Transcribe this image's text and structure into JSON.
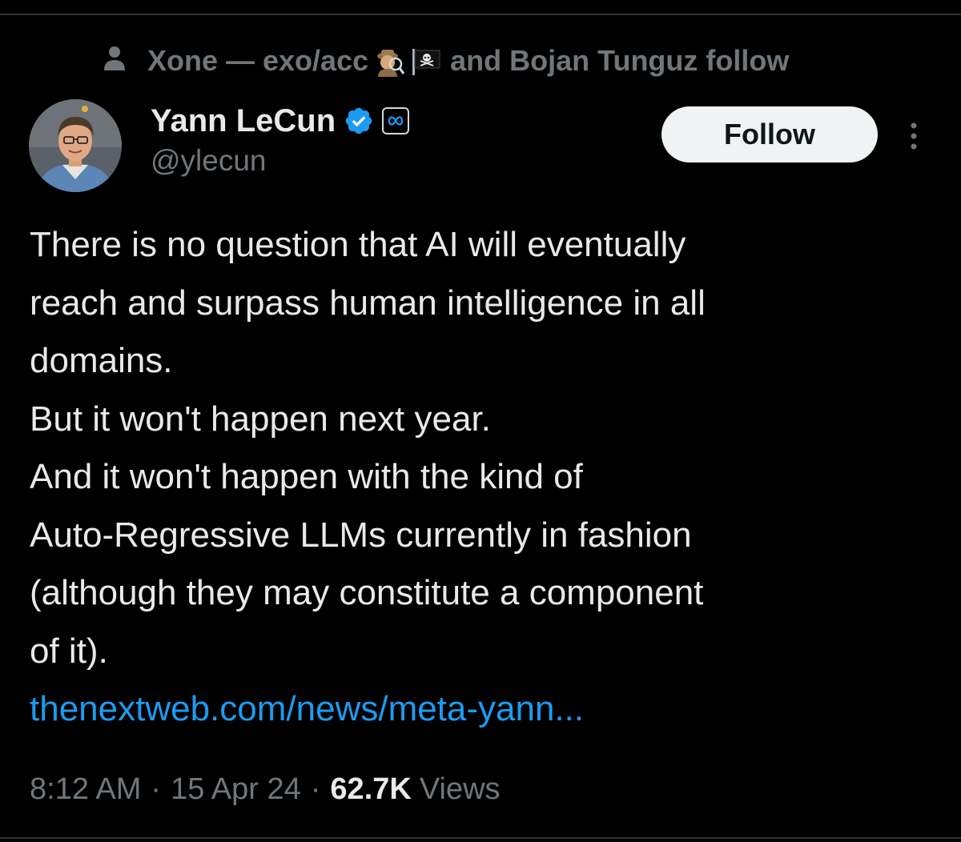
{
  "social_context": {
    "icon": "person-icon",
    "text_before": "Xone — exo/acc",
    "emojis": [
      "detective-emoji",
      "pirate-flag-emoji"
    ],
    "text_after": "and Bojan Tunguz follow"
  },
  "author": {
    "avatar": "avatar",
    "display_name": "Yann LeCun",
    "handle": "@ylecun",
    "verified_icon": "verified-badge-icon",
    "affiliate_icon": "meta-logo-icon"
  },
  "actions": {
    "follow_label": "Follow",
    "more_icon": "more-options-icon"
  },
  "tweet": {
    "lines": [
      "There is no question that AI will eventually",
      "reach and surpass human intelligence in all",
      "domains.",
      "But it won't happen next year.",
      "And it won't happen with the kind of",
      "Auto-Regressive LLMs currently in fashion",
      "(although they may constitute a component",
      "of it)."
    ],
    "link": "thenextweb.com/news/meta-yann..."
  },
  "meta": {
    "time": "8:12 AM",
    "separator": "·",
    "date": "15 Apr 24",
    "views_count": "62.7K",
    "views_label": "Views"
  },
  "colors": {
    "background": "#000000",
    "text": "#e7e9ea",
    "secondary": "#71767b",
    "link": "#1d9bf0",
    "verified": "#1d9bf0",
    "button_bg": "#eff3f4"
  }
}
